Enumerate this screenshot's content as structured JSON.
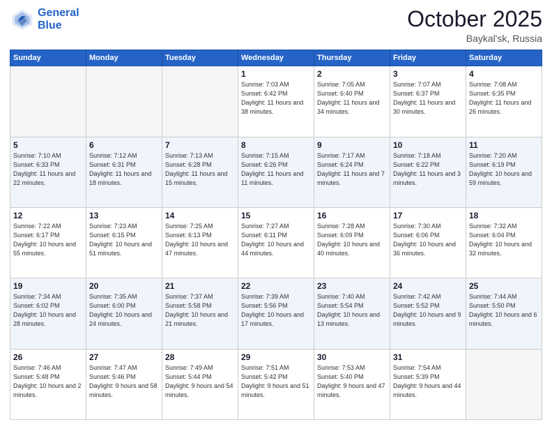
{
  "header": {
    "logo_line1": "General",
    "logo_line2": "Blue",
    "month": "October 2025",
    "location": "Baykal'sk, Russia"
  },
  "weekdays": [
    "Sunday",
    "Monday",
    "Tuesday",
    "Wednesday",
    "Thursday",
    "Friday",
    "Saturday"
  ],
  "weeks": [
    {
      "shade": false,
      "days": [
        null,
        null,
        null,
        {
          "n": "1",
          "sr": "7:03 AM",
          "ss": "6:42 PM",
          "dl": "11 hours and 38 minutes."
        },
        {
          "n": "2",
          "sr": "7:05 AM",
          "ss": "6:40 PM",
          "dl": "11 hours and 34 minutes."
        },
        {
          "n": "3",
          "sr": "7:07 AM",
          "ss": "6:37 PM",
          "dl": "11 hours and 30 minutes."
        },
        {
          "n": "4",
          "sr": "7:08 AM",
          "ss": "6:35 PM",
          "dl": "11 hours and 26 minutes."
        }
      ]
    },
    {
      "shade": true,
      "days": [
        {
          "n": "5",
          "sr": "7:10 AM",
          "ss": "6:33 PM",
          "dl": "11 hours and 22 minutes."
        },
        {
          "n": "6",
          "sr": "7:12 AM",
          "ss": "6:31 PM",
          "dl": "11 hours and 18 minutes."
        },
        {
          "n": "7",
          "sr": "7:13 AM",
          "ss": "6:28 PM",
          "dl": "11 hours and 15 minutes."
        },
        {
          "n": "8",
          "sr": "7:15 AM",
          "ss": "6:26 PM",
          "dl": "11 hours and 11 minutes."
        },
        {
          "n": "9",
          "sr": "7:17 AM",
          "ss": "6:24 PM",
          "dl": "11 hours and 7 minutes."
        },
        {
          "n": "10",
          "sr": "7:18 AM",
          "ss": "6:22 PM",
          "dl": "11 hours and 3 minutes."
        },
        {
          "n": "11",
          "sr": "7:20 AM",
          "ss": "6:19 PM",
          "dl": "10 hours and 59 minutes."
        }
      ]
    },
    {
      "shade": false,
      "days": [
        {
          "n": "12",
          "sr": "7:22 AM",
          "ss": "6:17 PM",
          "dl": "10 hours and 55 minutes."
        },
        {
          "n": "13",
          "sr": "7:23 AM",
          "ss": "6:15 PM",
          "dl": "10 hours and 51 minutes."
        },
        {
          "n": "14",
          "sr": "7:25 AM",
          "ss": "6:13 PM",
          "dl": "10 hours and 47 minutes."
        },
        {
          "n": "15",
          "sr": "7:27 AM",
          "ss": "6:11 PM",
          "dl": "10 hours and 44 minutes."
        },
        {
          "n": "16",
          "sr": "7:28 AM",
          "ss": "6:09 PM",
          "dl": "10 hours and 40 minutes."
        },
        {
          "n": "17",
          "sr": "7:30 AM",
          "ss": "6:06 PM",
          "dl": "10 hours and 36 minutes."
        },
        {
          "n": "18",
          "sr": "7:32 AM",
          "ss": "6:04 PM",
          "dl": "10 hours and 32 minutes."
        }
      ]
    },
    {
      "shade": true,
      "days": [
        {
          "n": "19",
          "sr": "7:34 AM",
          "ss": "6:02 PM",
          "dl": "10 hours and 28 minutes."
        },
        {
          "n": "20",
          "sr": "7:35 AM",
          "ss": "6:00 PM",
          "dl": "10 hours and 24 minutes."
        },
        {
          "n": "21",
          "sr": "7:37 AM",
          "ss": "5:58 PM",
          "dl": "10 hours and 21 minutes."
        },
        {
          "n": "22",
          "sr": "7:39 AM",
          "ss": "5:56 PM",
          "dl": "10 hours and 17 minutes."
        },
        {
          "n": "23",
          "sr": "7:40 AM",
          "ss": "5:54 PM",
          "dl": "10 hours and 13 minutes."
        },
        {
          "n": "24",
          "sr": "7:42 AM",
          "ss": "5:52 PM",
          "dl": "10 hours and 9 minutes."
        },
        {
          "n": "25",
          "sr": "7:44 AM",
          "ss": "5:50 PM",
          "dl": "10 hours and 6 minutes."
        }
      ]
    },
    {
      "shade": false,
      "days": [
        {
          "n": "26",
          "sr": "7:46 AM",
          "ss": "5:48 PM",
          "dl": "10 hours and 2 minutes."
        },
        {
          "n": "27",
          "sr": "7:47 AM",
          "ss": "5:46 PM",
          "dl": "9 hours and 58 minutes."
        },
        {
          "n": "28",
          "sr": "7:49 AM",
          "ss": "5:44 PM",
          "dl": "9 hours and 54 minutes."
        },
        {
          "n": "29",
          "sr": "7:51 AM",
          "ss": "5:42 PM",
          "dl": "9 hours and 51 minutes."
        },
        {
          "n": "30",
          "sr": "7:53 AM",
          "ss": "5:40 PM",
          "dl": "9 hours and 47 minutes."
        },
        {
          "n": "31",
          "sr": "7:54 AM",
          "ss": "5:39 PM",
          "dl": "9 hours and 44 minutes."
        },
        null
      ]
    }
  ]
}
